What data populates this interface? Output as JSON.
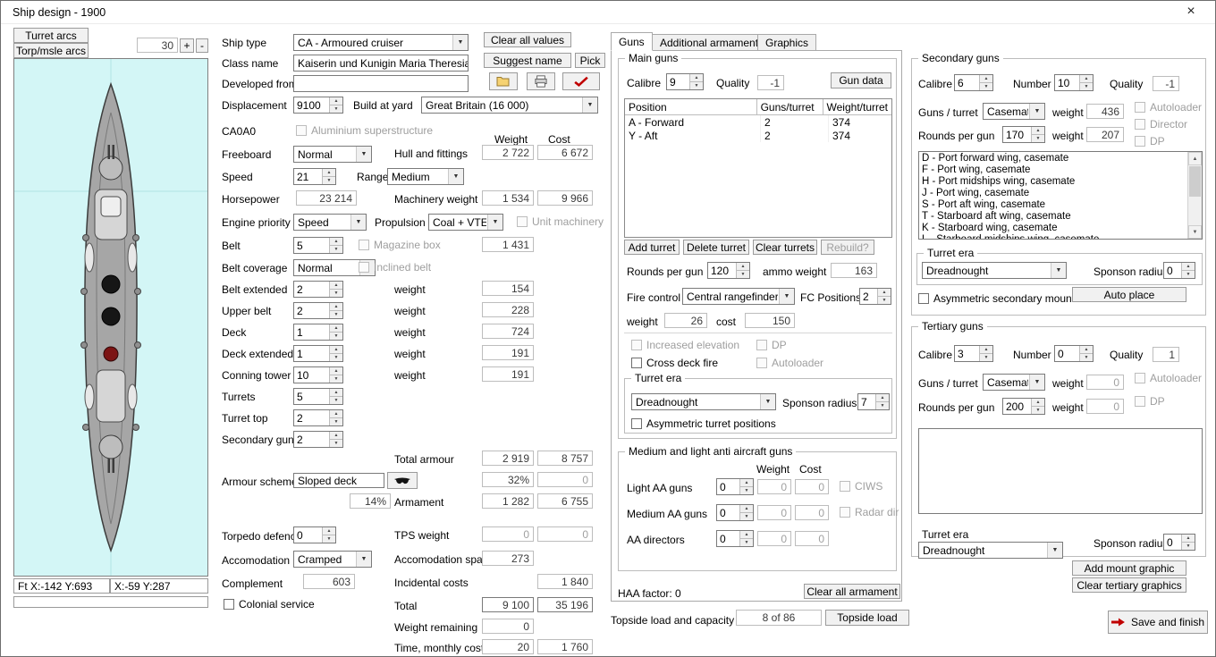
{
  "window": {
    "title": "Ship design - 1900",
    "close_icon": "×"
  },
  "arcs": {
    "turret_btn": "Turret arcs",
    "torp_btn": "Torp/msle arcs",
    "value": "30",
    "plus": "+",
    "minus": "-"
  },
  "shipview": {
    "status_left": "Ft X:-142 Y:693",
    "status_right": "X:-59 Y:287"
  },
  "topbtns": {
    "clear_all": "Clear all values",
    "suggest": "Suggest name",
    "pick": "Pick"
  },
  "form": {
    "ship_type": {
      "label": "Ship type",
      "value": "CA - Armoured cruiser"
    },
    "class_name": {
      "label": "Class name",
      "value": "Kaiserin und Kunigin Maria Theresia"
    },
    "developed_from": {
      "label": "Developed from",
      "value": ""
    },
    "displacement": {
      "label": "Displacement",
      "value": "9100"
    },
    "build_at_yard": {
      "label": "Build at yard",
      "value": "Great Britain (16 000)"
    },
    "code": "CA0A0",
    "aluminium": "Aluminium superstructure",
    "freeboard": {
      "label": "Freeboard",
      "value": "Normal"
    },
    "speed": {
      "label": "Speed",
      "value": "21"
    },
    "range": {
      "label": "Range",
      "value": "Medium"
    },
    "horsepower": {
      "label": "Horsepower",
      "value": "23 214"
    },
    "engine_priority": {
      "label": "Engine priority",
      "value": "Speed"
    },
    "propulsion": {
      "label": "Propulsion",
      "value": "Coal + VTE"
    },
    "unit_machinery": "Unit machinery",
    "belt": {
      "label": "Belt",
      "value": "5"
    },
    "magazine_box": "Magazine box",
    "belt_coverage": {
      "label": "Belt coverage",
      "value": "Normal"
    },
    "inclined_belt": "Inclined belt",
    "belt_extended": {
      "label": "Belt extended",
      "value": "2"
    },
    "upper_belt": {
      "label": "Upper belt",
      "value": "2"
    },
    "deck": {
      "label": "Deck",
      "value": "1"
    },
    "deck_extended": {
      "label": "Deck extended",
      "value": "1"
    },
    "conning_tower": {
      "label": "Conning tower",
      "value": "10"
    },
    "turrets": {
      "label": "Turrets",
      "value": "5"
    },
    "turret_top": {
      "label": "Turret top",
      "value": "2"
    },
    "secondary_guns": {
      "label": "Secondary guns",
      "value": "2"
    },
    "armour_scheme": {
      "label": "Armour scheme",
      "value": "Sloped deck"
    },
    "armour_pct": "14%",
    "torpedo_defence": {
      "label": "Torpedo defence",
      "value": "0"
    },
    "accomodation": {
      "label": "Accomodation",
      "value": "Cramped"
    },
    "complement": {
      "label": "Complement",
      "value": "603"
    },
    "colonial_service": "Colonial service"
  },
  "costs": {
    "weight_hdr": "Weight",
    "cost_hdr": "Cost",
    "hull": {
      "label": "Hull and fittings",
      "weight": "2 722",
      "cost": "6 672"
    },
    "machinery": {
      "label": "Machinery weight",
      "weight": "1 534",
      "cost": "9 966"
    },
    "belt_weight": "1 431",
    "weight_label": "weight",
    "weights": {
      "belt_extended": "154",
      "upper_belt": "228",
      "deck": "724",
      "deck_extended": "191",
      "conning_tower": "191"
    },
    "total_armour": {
      "label": "Total armour",
      "weight": "2 919",
      "cost": "8 757"
    },
    "armour_pct_row": {
      "weight": "32%",
      "cost": "0"
    },
    "armament": {
      "label": "Armament",
      "weight": "1 282",
      "cost": "6 755"
    },
    "tps": {
      "label": "TPS weight",
      "weight": "0",
      "cost": "0"
    },
    "accomodation_space": {
      "label": "Accomodation space",
      "value": "273"
    },
    "incidental": {
      "label": "Incidental costs",
      "cost": "1 840"
    },
    "total": {
      "label": "Total",
      "weight": "9 100",
      "cost": "35 196"
    },
    "weight_remaining": {
      "label": "Weight remaining",
      "value": "0"
    },
    "time_cost": {
      "label": "Time, monthly cost",
      "weight": "20",
      "cost": "1 760"
    }
  },
  "tabs": {
    "guns": "Guns",
    "additional": "Additional armament",
    "graphics": "Graphics"
  },
  "main_guns": {
    "title": "Main guns",
    "calibre_label": "Calibre",
    "calibre": "9",
    "quality_label": "Quality",
    "quality": "-1",
    "gun_data_btn": "Gun data",
    "table": {
      "headers": [
        "Position",
        "Guns/turret",
        "Weight/turret"
      ],
      "rows": [
        {
          "pos": "A - Forward",
          "guns": "2",
          "wt": "374"
        },
        {
          "pos": "Y - Aft",
          "guns": "2",
          "wt": "374"
        }
      ]
    },
    "add_btn": "Add turret",
    "del_btn": "Delete turret",
    "clear_btn": "Clear turrets",
    "rebuild_btn": "Rebuild?",
    "rpg_label": "Rounds per gun",
    "rpg": "120",
    "ammo_label": "ammo weight",
    "ammo": "163",
    "fc_label": "Fire control",
    "fc": "Central rangefinder",
    "fcpos_label": "FC Positions",
    "fcpos": "2",
    "weight_label": "weight",
    "weight": "26",
    "cost_label": "cost",
    "cost": "150",
    "cb_elev": "Increased elevation",
    "cb_dp": "DP",
    "cb_cross": "Cross deck fire",
    "cb_auto": "Autoloader",
    "era": {
      "title": "Turret era",
      "value": "Dreadnought",
      "sponson_label": "Sponson radius",
      "sponson": "7",
      "asym": "Asymmetric turret positions"
    }
  },
  "aa": {
    "title": "Medium and light anti aircraft guns",
    "weight_hdr": "Weight",
    "cost_hdr": "Cost",
    "rows": [
      {
        "label": "Light AA guns",
        "num": "0",
        "weight": "0",
        "cost": "0",
        "cb": "CIWS"
      },
      {
        "label": "Medium AA guns",
        "num": "0",
        "weight": "0",
        "cost": "0",
        "cb": "Radar dir"
      },
      {
        "label": "AA directors",
        "num": "0",
        "weight": "0",
        "cost": "0"
      }
    ],
    "haa": "HAA factor: 0",
    "clear_btn": "Clear all armament"
  },
  "topside": {
    "label": "Topside load and capacity",
    "value": "8 of 86",
    "btn": "Topside load"
  },
  "secondary": {
    "title": "Secondary guns",
    "calibre_label": "Calibre",
    "calibre": "6",
    "number_label": "Number",
    "number": "10",
    "quality_label": "Quality",
    "quality": "-1",
    "gpt_label": "Guns / turret",
    "gpt": "Casemat",
    "weight_label": "weight",
    "weight": "436",
    "autoloader": "Autoloader",
    "rpg_label": "Rounds per gun",
    "rpg": "170",
    "weight2": "207",
    "director": "Director",
    "dp": "DP",
    "positions": [
      "D - Port forward wing, casemate",
      "F - Port wing, casemate",
      "H - Port midships wing, casemate",
      "J - Port wing, casemate",
      "S - Port aft wing, casemate",
      "T - Starboard aft wing, casemate",
      "K - Starboard wing, casemate",
      "L - Starboard midships wing, casemate"
    ],
    "era": {
      "title": "Turret era",
      "value": "Dreadnought",
      "sponson_label": "Sponson radius",
      "sponson": "0"
    },
    "asym": "Asymmetric secondary mounts",
    "auto_place_btn": "Auto place"
  },
  "tertiary": {
    "title": "Tertiary guns",
    "calibre_label": "Calibre",
    "calibre": "3",
    "number_label": "Number",
    "number": "0",
    "quality_label": "Quality",
    "quality": "1",
    "gpt_label": "Guns / turret",
    "gpt": "Casemat",
    "weight_label": "weight",
    "weight": "0",
    "autoloader": "Autoloader",
    "rpg_label": "Rounds per gun",
    "rpg": "200",
    "weight2": "0",
    "dp": "DP",
    "era_label": "Turret era",
    "era_value": "Dreadnought",
    "sponson_label": "Sponson radius",
    "sponson": "0",
    "add_graphic_btn": "Add mount graphic",
    "clear_graphics_btn": "Clear tertiary graphics"
  },
  "save_btn": "Save and finish",
  "colors": {
    "accent_red": "#c00000",
    "canvas_bg": "#d3f6f6",
    "hull_gray": "#a6a6a6"
  }
}
